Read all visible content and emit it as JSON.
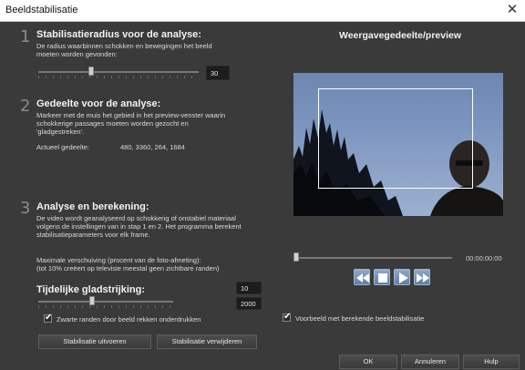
{
  "window": {
    "title": "Beeldstabilisatie",
    "close_glyph": "✕"
  },
  "step1": {
    "number": "1",
    "heading": "Stabilisatieradius voor de analyse:",
    "description": "De radius waarbinnen schokken en bewegingen het beeld\nmoeten worden gevonden:",
    "value": "30",
    "slider_position": 0.33
  },
  "step2": {
    "number": "2",
    "heading": "Gedeelte voor de analyse:",
    "description": "Markeer met de muis het gebied in het preview-venster waarin\nschokkerige passages moeten worden gezocht en\n'gladgestreken'.",
    "area_label": "Actueel gedeelte:",
    "area_value": "480, 3360, 264, 1684"
  },
  "step3": {
    "number": "3",
    "heading": "Analyse en berekening:",
    "description": "De video wordt geanalyseerd op schokkerig of onstabiel materiaal\nvolgens de instellingen van in stap 1 en 2. Het programma berekent\nstabilisatieparameters voor elk frame.",
    "max_shift_text": "Maximale verschuiving (procent van de foto-afmeting):\n(tot 10% creëert op televisie meestal geen zichtbare randen)",
    "max_shift_value": "10",
    "temporal_label": "Tijdelijke gladstrijking:",
    "temporal_value": "2000",
    "temporal_slider_position": 0.4,
    "black_borders_label": "Zwarte randen door beeld rekken onderdrukken",
    "black_borders_checked": true,
    "run_button": "Stabilisatie uitvoeren",
    "remove_button": "Stabilisatie verwijderen"
  },
  "preview": {
    "title": "Weergavegedeelte/preview",
    "timecode": "00:00:00:00",
    "transport": {
      "rewind_icon": "rewind-icon",
      "stop_icon": "stop-icon",
      "play_icon": "play-icon",
      "forward_icon": "fast-forward-icon"
    },
    "preview_checkbox_label": "Voorbeeld met berekende beeldstabilisatie",
    "preview_checked": true
  },
  "footer": {
    "ok": "OK",
    "cancel": "Annuleren",
    "help": "Hulp"
  },
  "colors": {
    "background": "#3a3a3a",
    "accent_blue": "#6f8fb5",
    "text": "#e6e6e6"
  }
}
